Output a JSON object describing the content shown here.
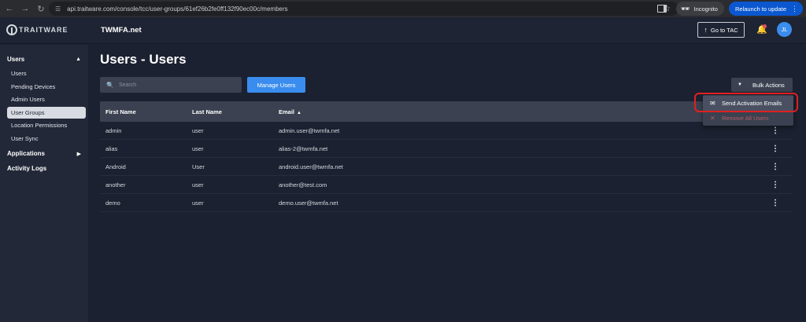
{
  "browser": {
    "url": "api.traitware.com/console/tcc/user-groups/61ef26b2fe0ff132f90ec00c/members",
    "incognito_label": "Incognito",
    "relaunch_label": "Relaunch to update"
  },
  "header": {
    "logo_text": "TRAITWARE",
    "org_name": "TWMFA.net",
    "goto_tac_label": "Go to TAC",
    "avatar_initials": "JL"
  },
  "sidebar": {
    "users_section": "Users",
    "items": [
      {
        "label": "Users"
      },
      {
        "label": "Pending Devices"
      },
      {
        "label": "Admin Users"
      },
      {
        "label": "User Groups",
        "active": true
      },
      {
        "label": "Location Permissions"
      },
      {
        "label": "User Sync"
      }
    ],
    "applications_section": "Applications",
    "activity_logs_section": "Activity Logs"
  },
  "main": {
    "title": "Users - Users",
    "search_placeholder": "Search",
    "manage_users_label": "Manage Users",
    "bulk_actions_label": "Bulk Actions",
    "bulk_menu": {
      "send_activation": "Send Activation Emails",
      "remove_all": "Remove All Users"
    },
    "table": {
      "headers": {
        "first_name": "First Name",
        "last_name": "Last Name",
        "email": "Email"
      },
      "rows": [
        {
          "first": "admin",
          "last": "user",
          "email": "admin.user@twmfa.net"
        },
        {
          "first": "alias",
          "last": "user",
          "email": "alias-2@twmfa.net"
        },
        {
          "first": "Android",
          "last": "User",
          "email": "android.user@twmfa.net"
        },
        {
          "first": "another",
          "last": "user",
          "email": "another@test.com"
        },
        {
          "first": "demo",
          "last": "user",
          "email": "demo.user@twmfa.net"
        }
      ]
    }
  },
  "colors": {
    "accent": "#3a8dee",
    "background": "#1b2130",
    "highlight_box": "#e02020",
    "danger_text": "#b65e64"
  }
}
